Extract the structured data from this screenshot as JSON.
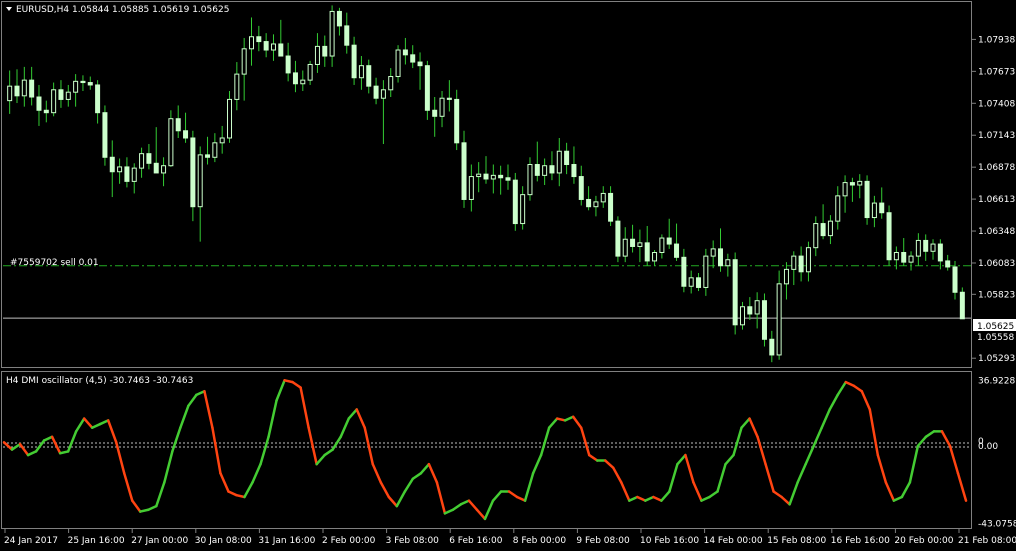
{
  "window": {
    "symbol_header": "EURUSD,H4  1.05844 1.05885 1.05619 1.05625",
    "indicator_header": "H4 DMI oscillator (4,5) -30.7463 -30.7463",
    "order_label": "#7559702 sell 0.01",
    "current_price_label": "1.05625",
    "hidden_price_label": "1.05558"
  },
  "colors": {
    "background": "#000000",
    "frame": "#808080",
    "bull_candle_body": "#000000",
    "bear_candle_body": "#ccffcc",
    "candle_outline": "#ccffcc",
    "wick": "#33cc33",
    "order_line": "#22aa22",
    "price_line": "#c0c0c0",
    "osc_rising": "#44cc33",
    "osc_falling": "#ff4411",
    "zero_line": "#c0c0c0"
  },
  "price_axis": {
    "labels": [
      "1.07938",
      "1.07673",
      "1.07408",
      "1.07143",
      "1.06878",
      "1.06613",
      "1.06348",
      "1.06083",
      "1.05823",
      "1.05293"
    ],
    "min": 1.0522,
    "max": 1.0824
  },
  "osc_axis": {
    "labels": [
      "36.9228",
      "0",
      "0.00",
      "-43.0758"
    ],
    "min": -45,
    "max": 40
  },
  "time_axis": {
    "labels": [
      "24 Jan 2017",
      "25 Jan 16:00",
      "27 Jan 00:00",
      "30 Jan 08:00",
      "31 Jan 16:00",
      "2 Feb 00:00",
      "3 Feb 08:00",
      "6 Feb 16:00",
      "8 Feb 00:00",
      "9 Feb 08:00",
      "10 Feb 16:00",
      "14 Feb 00:00",
      "15 Feb 08:00",
      "16 Feb 16:00",
      "20 Feb 00:00",
      "21 Feb 08:00"
    ]
  },
  "chart_data": [
    {
      "type": "candlestick",
      "title": "EURUSD,H4  1.05844 1.05885 1.05619 1.05625",
      "order_level": 1.0606,
      "current_price": 1.05625,
      "ohlc": [
        [
          1.0743,
          1.0768,
          1.0732,
          1.0755
        ],
        [
          1.0755,
          1.0769,
          1.0741,
          1.0747
        ],
        [
          1.0747,
          1.0771,
          1.0738,
          1.076
        ],
        [
          1.076,
          1.0771,
          1.0739,
          1.0746
        ],
        [
          1.0746,
          1.0756,
          1.0722,
          1.0735
        ],
        [
          1.0735,
          1.0743,
          1.0725,
          1.0733
        ],
        [
          1.0733,
          1.0758,
          1.073,
          1.0752
        ],
        [
          1.0752,
          1.076,
          1.0737,
          1.0744
        ],
        [
          1.0744,
          1.0756,
          1.0738,
          1.075
        ],
        [
          1.075,
          1.0765,
          1.0738,
          1.0759
        ],
        [
          1.0759,
          1.0764,
          1.0751,
          1.0758
        ],
        [
          1.0758,
          1.0763,
          1.0752,
          1.0756
        ],
        [
          1.0756,
          1.076,
          1.0724,
          1.0733
        ],
        [
          1.0733,
          1.0739,
          1.0689,
          1.0696
        ],
        [
          1.0696,
          1.071,
          1.0663,
          1.0684
        ],
        [
          1.0684,
          1.0695,
          1.0674,
          1.0688
        ],
        [
          1.0688,
          1.0696,
          1.0671,
          1.0676
        ],
        [
          1.0676,
          1.0691,
          1.0666,
          1.0687
        ],
        [
          1.0687,
          1.0704,
          1.0679,
          1.0699
        ],
        [
          1.0699,
          1.0707,
          1.0686,
          1.0691
        ],
        [
          1.0691,
          1.0721,
          1.0683,
          1.0683
        ],
        [
          1.0683,
          1.0696,
          1.0672,
          1.0689
        ],
        [
          1.0689,
          1.0735,
          1.0688,
          1.0728
        ],
        [
          1.0728,
          1.0739,
          1.0712,
          1.0718
        ],
        [
          1.0718,
          1.0733,
          1.0708,
          1.0712
        ],
        [
          1.0712,
          1.0718,
          1.0643,
          1.0655
        ],
        [
          1.0655,
          1.0705,
          1.0626,
          1.0698
        ],
        [
          1.0698,
          1.0713,
          1.069,
          1.0696
        ],
        [
          1.0696,
          1.0716,
          1.0692,
          1.0708
        ],
        [
          1.0708,
          1.0722,
          1.0699,
          1.0712
        ],
        [
          1.0712,
          1.0751,
          1.0708,
          1.0744
        ],
        [
          1.0744,
          1.0775,
          1.0735,
          1.0765
        ],
        [
          1.0765,
          1.0795,
          1.0743,
          1.0786
        ],
        [
          1.0786,
          1.0812,
          1.0772,
          1.0796
        ],
        [
          1.0796,
          1.0805,
          1.0784,
          1.0792
        ],
        [
          1.0792,
          1.0799,
          1.0779,
          1.0785
        ],
        [
          1.0785,
          1.0798,
          1.0776,
          1.079
        ],
        [
          1.079,
          1.081,
          1.078,
          1.078
        ],
        [
          1.078,
          1.0791,
          1.0759,
          1.0766
        ],
        [
          1.0766,
          1.0776,
          1.075,
          1.0757
        ],
        [
          1.0757,
          1.0768,
          1.0751,
          1.076
        ],
        [
          1.076,
          1.0776,
          1.0756,
          1.0773
        ],
        [
          1.0773,
          1.0799,
          1.0766,
          1.0788
        ],
        [
          1.0788,
          1.0797,
          1.0771,
          1.078
        ],
        [
          1.078,
          1.0822,
          1.0771,
          1.0817
        ],
        [
          1.0817,
          1.082,
          1.0797,
          1.0805
        ],
        [
          1.0805,
          1.0816,
          1.0782,
          1.0789
        ],
        [
          1.0789,
          1.0796,
          1.0756,
          1.0762
        ],
        [
          1.0762,
          1.078,
          1.0752,
          1.0772
        ],
        [
          1.0772,
          1.0777,
          1.0749,
          1.0755
        ],
        [
          1.0755,
          1.0762,
          1.074,
          1.0745
        ],
        [
          1.0745,
          1.076,
          1.0707,
          1.0752
        ],
        [
          1.0752,
          1.077,
          1.0746,
          1.0763
        ],
        [
          1.0763,
          1.0789,
          1.0758,
          1.0785
        ],
        [
          1.0785,
          1.0795,
          1.0773,
          1.0781
        ],
        [
          1.0781,
          1.0789,
          1.077,
          1.0775
        ],
        [
          1.0775,
          1.0783,
          1.0752,
          1.0772
        ],
        [
          1.0772,
          1.0776,
          1.0727,
          1.0735
        ],
        [
          1.0735,
          1.0746,
          1.0713,
          1.073
        ],
        [
          1.073,
          1.0751,
          1.0721,
          1.0745
        ],
        [
          1.0745,
          1.076,
          1.0734,
          1.0744
        ],
        [
          1.0744,
          1.0752,
          1.0702,
          1.0708
        ],
        [
          1.0708,
          1.0718,
          1.0654,
          1.0661
        ],
        [
          1.0661,
          1.069,
          1.0651,
          1.068
        ],
        [
          1.068,
          1.0692,
          1.0667,
          1.0682
        ],
        [
          1.0682,
          1.0697,
          1.0674,
          1.0678
        ],
        [
          1.0678,
          1.069,
          1.0666,
          1.0681
        ],
        [
          1.0681,
          1.0689,
          1.0665,
          1.0679
        ],
        [
          1.0679,
          1.069,
          1.0669,
          1.0677
        ],
        [
          1.0677,
          1.0683,
          1.0635,
          1.0641
        ],
        [
          1.0641,
          1.0672,
          1.0636,
          1.0665
        ],
        [
          1.0665,
          1.0696,
          1.066,
          1.069
        ],
        [
          1.069,
          1.0709,
          1.0676,
          1.0681
        ],
        [
          1.0681,
          1.0695,
          1.0673,
          1.0689
        ],
        [
          1.0689,
          1.0701,
          1.0677,
          1.0683
        ],
        [
          1.0683,
          1.0712,
          1.0672,
          1.0701
        ],
        [
          1.0701,
          1.0708,
          1.0682,
          1.069
        ],
        [
          1.069,
          1.0705,
          1.0674,
          1.068
        ],
        [
          1.068,
          1.0689,
          1.0656,
          1.0661
        ],
        [
          1.0661,
          1.0672,
          1.0652,
          1.0655
        ],
        [
          1.0655,
          1.0664,
          1.0647,
          1.0659
        ],
        [
          1.0659,
          1.0672,
          1.0654,
          1.0666
        ],
        [
          1.0666,
          1.0672,
          1.0639,
          1.0643
        ],
        [
          1.0643,
          1.0647,
          1.0609,
          1.0614
        ],
        [
          1.0614,
          1.0638,
          1.0609,
          1.0628
        ],
        [
          1.0628,
          1.064,
          1.0617,
          1.0622
        ],
        [
          1.0622,
          1.0636,
          1.0609,
          1.0625
        ],
        [
          1.0625,
          1.0639,
          1.0606,
          1.061
        ],
        [
          1.061,
          1.0619,
          1.0606,
          1.0617
        ],
        [
          1.0617,
          1.0632,
          1.0612,
          1.0629
        ],
        [
          1.0629,
          1.0645,
          1.062,
          1.0624
        ],
        [
          1.0624,
          1.0641,
          1.061,
          1.0613
        ],
        [
          1.0613,
          1.062,
          1.0584,
          1.0589
        ],
        [
          1.0589,
          1.0602,
          1.0583,
          1.0596
        ],
        [
          1.0596,
          1.06,
          1.0585,
          1.0588
        ],
        [
          1.0588,
          1.062,
          1.0581,
          1.0614
        ],
        [
          1.0614,
          1.0627,
          1.0604,
          1.062
        ],
        [
          1.062,
          1.0637,
          1.0601,
          1.0606
        ],
        [
          1.0606,
          1.0616,
          1.0597,
          1.0611
        ],
        [
          1.0611,
          1.0617,
          1.0549,
          1.0557
        ],
        [
          1.0557,
          1.0576,
          1.0553,
          1.0572
        ],
        [
          1.0572,
          1.058,
          1.0561,
          1.0566
        ],
        [
          1.0566,
          1.0584,
          1.0554,
          1.0577
        ],
        [
          1.0577,
          1.0583,
          1.0539,
          1.0545
        ],
        [
          1.0545,
          1.0552,
          1.0526,
          1.0532
        ],
        [
          1.0532,
          1.0602,
          1.0528,
          1.0591
        ],
        [
          1.0591,
          1.0609,
          1.0578,
          1.0603
        ],
        [
          1.0603,
          1.0618,
          1.059,
          1.0614
        ],
        [
          1.0614,
          1.0622,
          1.0593,
          1.0601
        ],
        [
          1.0601,
          1.0626,
          1.0593,
          1.0621
        ],
        [
          1.0621,
          1.0647,
          1.0614,
          1.0641
        ],
        [
          1.0641,
          1.0657,
          1.0628,
          1.0631
        ],
        [
          1.0631,
          1.0648,
          1.0624,
          1.0643
        ],
        [
          1.0643,
          1.0672,
          1.0636,
          1.0664
        ],
        [
          1.0664,
          1.0681,
          1.065,
          1.0675
        ],
        [
          1.0675,
          1.0679,
          1.0659,
          1.0673
        ],
        [
          1.0673,
          1.0682,
          1.0662,
          1.0676
        ],
        [
          1.0676,
          1.0681,
          1.064,
          1.0646
        ],
        [
          1.0646,
          1.0664,
          1.0638,
          1.0658
        ],
        [
          1.0658,
          1.0671,
          1.0645,
          1.065
        ],
        [
          1.065,
          1.0656,
          1.0606,
          1.0611
        ],
        [
          1.0611,
          1.0622,
          1.0603,
          1.0617
        ],
        [
          1.0617,
          1.0629,
          1.0606,
          1.0609
        ],
        [
          1.0609,
          1.0618,
          1.0602,
          1.0614
        ],
        [
          1.0614,
          1.0633,
          1.0606,
          1.0627
        ],
        [
          1.0627,
          1.0632,
          1.061,
          1.0618
        ],
        [
          1.0618,
          1.0628,
          1.0611,
          1.0624
        ],
        [
          1.0624,
          1.0628,
          1.0603,
          1.061
        ],
        [
          1.061,
          1.0615,
          1.0602,
          1.0605
        ],
        [
          1.0605,
          1.061,
          1.0578,
          1.0584
        ],
        [
          1.0584,
          1.0588,
          1.0562,
          1.0562
        ]
      ]
    },
    {
      "type": "line",
      "title": "H4 DMI oscillator (4,5) -30.7463 -30.7463",
      "ylim": [
        -43.0758,
        36.9228
      ],
      "zero_level": 0,
      "values": [
        2,
        -2,
        1,
        -5,
        -3,
        3,
        5,
        -4,
        -3,
        8,
        15,
        10,
        12,
        14,
        2,
        -15,
        -30,
        -36,
        -35,
        -33,
        -20,
        -3,
        10,
        22,
        28,
        30,
        10,
        -15,
        -25,
        -27,
        -28,
        -20,
        -10,
        5,
        25,
        36,
        35,
        32,
        10,
        -10,
        -5,
        -2,
        5,
        15,
        20,
        10,
        -10,
        -20,
        -28,
        -33,
        -25,
        -18,
        -15,
        -10,
        -20,
        -37,
        -35,
        -32,
        -30,
        -35,
        -40,
        -30,
        -25,
        -25,
        -28,
        -30,
        -15,
        -5,
        10,
        15,
        14,
        16,
        10,
        -5,
        -8,
        -8,
        -12,
        -20,
        -30,
        -28,
        -30,
        -28,
        -30,
        -25,
        -10,
        -5,
        -20,
        -30,
        -28,
        -25,
        -10,
        -5,
        10,
        15,
        5,
        -10,
        -25,
        -28,
        -32,
        -20,
        -10,
        0,
        10,
        20,
        28,
        35,
        33,
        30,
        20,
        -5,
        -20,
        -30,
        -28,
        -20,
        0,
        5,
        8,
        8,
        0,
        -15,
        -30
      ]
    }
  ]
}
